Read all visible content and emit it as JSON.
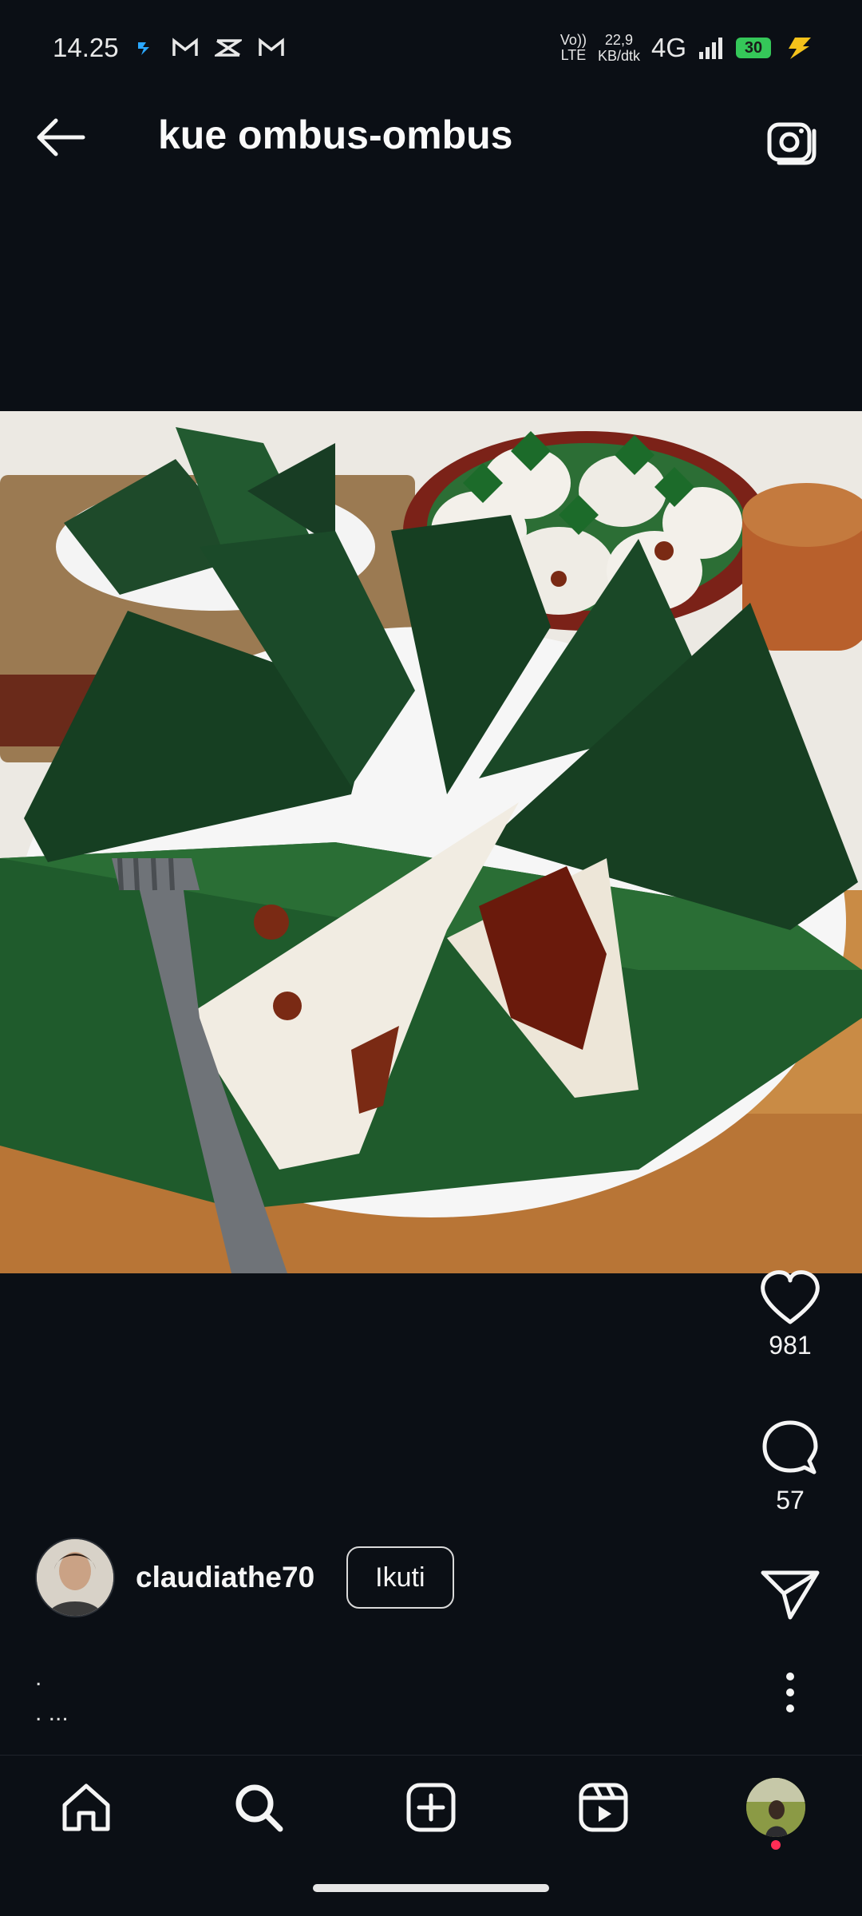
{
  "status_bar": {
    "time": "14.25",
    "notification_icons": [
      "capcut-icon",
      "gmail-icon",
      "capcut-alt-icon",
      "gmail-icon"
    ],
    "volte": "VoLTE",
    "net_speed_value": "22,9",
    "net_speed_unit": "KB/dtk",
    "network": "4G",
    "battery": "30"
  },
  "header": {
    "title": "kue ombus-ombus"
  },
  "post": {
    "likes": "981",
    "comments": "57",
    "author": "claudiathe70",
    "follow_label": "Ikuti",
    "caption_line1": ".",
    "caption_line2": ". ..."
  },
  "nav": {
    "items": [
      "home-icon",
      "search-icon",
      "create-icon",
      "reels-icon",
      "profile-avatar"
    ]
  },
  "colors": {
    "background": "#0b0f15",
    "banana_leaf": "#1d4d2b",
    "accent_red": "#ff2d55"
  }
}
